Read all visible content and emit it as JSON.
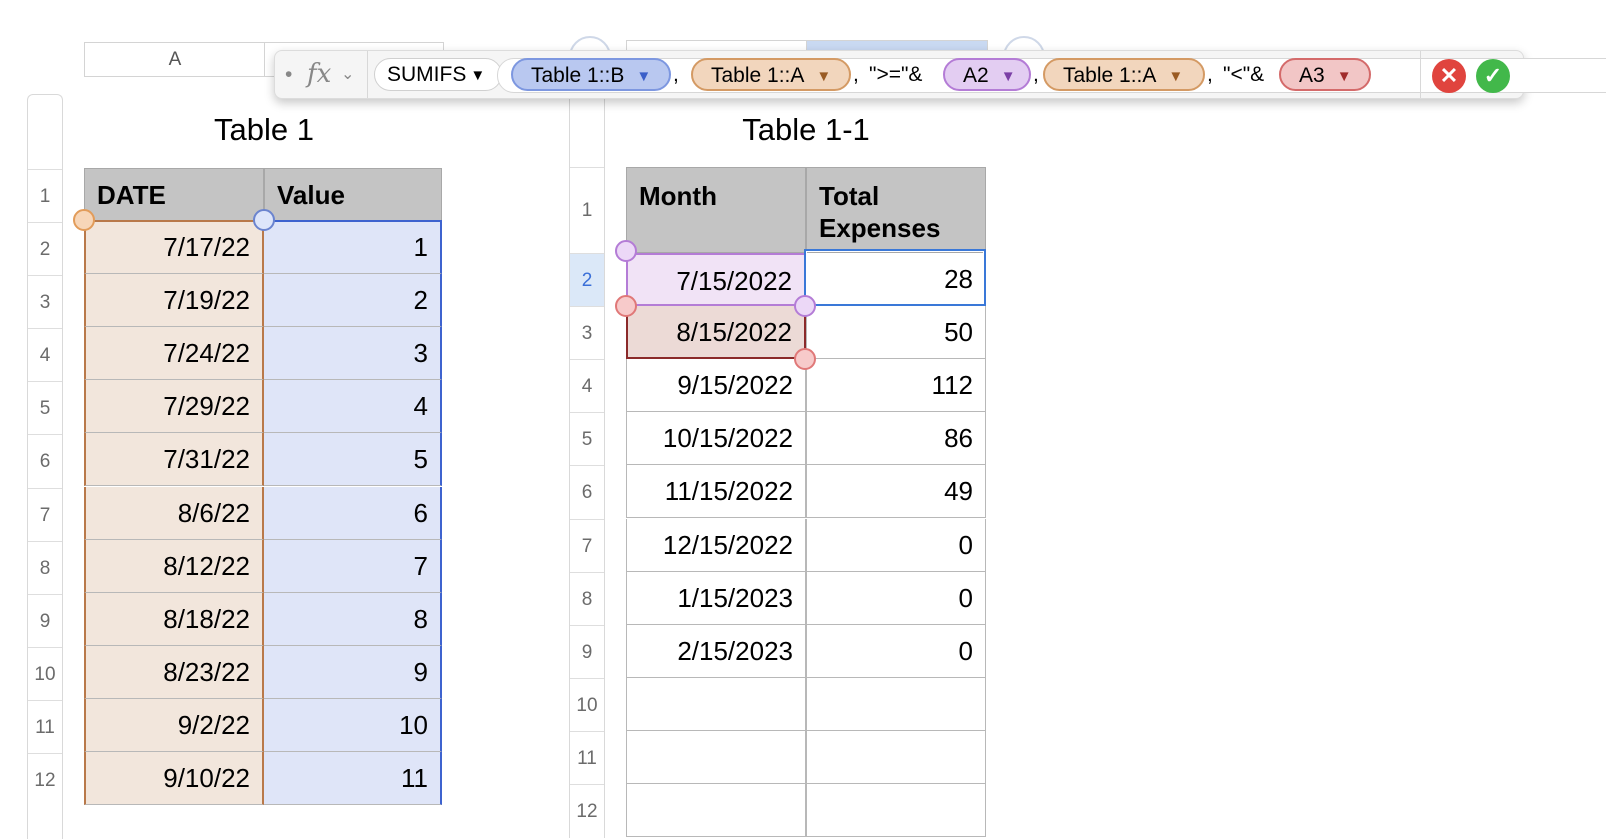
{
  "column_header_a": "A",
  "formula_bar": {
    "bullet": "•",
    "fx_label": "fx",
    "function_name": "SUMIFS",
    "sep1": ",",
    "sep2": ",",
    "sep3": ",",
    "sep4": ",",
    "text1": "\">=\"&",
    "text2": "\"<\"&",
    "tokens": [
      {
        "label": "Table 1::B",
        "color": "#b9c8f0"
      },
      {
        "label": "Table 1::A",
        "color": "#f2d6bd"
      },
      {
        "label": "A2",
        "color": "#e3cdf2"
      },
      {
        "label": "Table 1::A",
        "color": "#f2d6bd"
      },
      {
        "label": "A3",
        "color": "#f2c6c6"
      }
    ],
    "cancel_color": "#e0443e",
    "accept_color": "#42b84a"
  },
  "table1": {
    "title": "Table 1",
    "headers": [
      "DATE",
      "Value"
    ],
    "row_numbers": [
      "1",
      "2",
      "3",
      "4",
      "5",
      "6",
      "7",
      "8",
      "9",
      "10",
      "11",
      "12"
    ],
    "rows": [
      [
        "7/17/22",
        "1"
      ],
      [
        "7/19/22",
        "2"
      ],
      [
        "7/24/22",
        "3"
      ],
      [
        "7/29/22",
        "4"
      ],
      [
        "7/31/22",
        "5"
      ],
      [
        "8/6/22",
        "6"
      ],
      [
        "8/12/22",
        "7"
      ],
      [
        "8/18/22",
        "8"
      ],
      [
        "8/23/22",
        "9"
      ],
      [
        "9/2/22",
        "10"
      ],
      [
        "9/10/22",
        "11"
      ]
    ]
  },
  "table2": {
    "title": "Table 1-1",
    "headers": [
      "Month",
      "Total Expenses"
    ],
    "row_numbers": [
      "1",
      "2",
      "3",
      "4",
      "5",
      "6",
      "7",
      "8",
      "9",
      "10",
      "11",
      "12"
    ],
    "rows": [
      [
        "7/15/2022",
        "28"
      ],
      [
        "8/15/2022",
        "50"
      ],
      [
        "9/15/2022",
        "112"
      ],
      [
        "10/15/2022",
        "86"
      ],
      [
        "11/15/2022",
        "49"
      ],
      [
        "12/15/2022",
        "0"
      ],
      [
        "1/15/2023",
        "0"
      ],
      [
        "2/15/2023",
        "0"
      ],
      [
        "",
        ""
      ],
      [
        "",
        ""
      ],
      [
        "",
        ""
      ]
    ]
  },
  "colors": {
    "date_highlight": "#f2e6dc",
    "value_highlight": "#dfe5f8",
    "a2_highlight": "#f1e3f6",
    "a3_highlight": "#ecdad6",
    "selection_blue": "#3a78d8",
    "header_gray": "#c4c4c4"
  }
}
